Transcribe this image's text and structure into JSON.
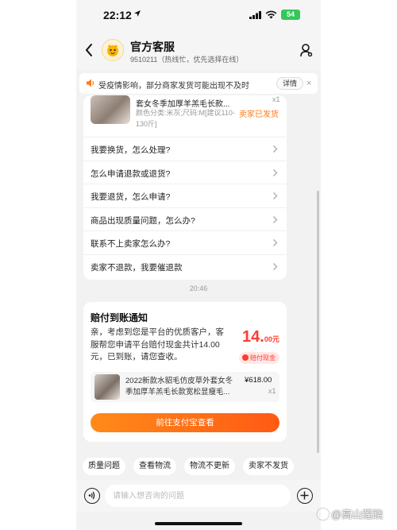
{
  "status_bar": {
    "time": "22:12",
    "battery": "54"
  },
  "header": {
    "title": "官方客服",
    "subtitle": "9510211（热线忙，优先选择在线）"
  },
  "notice": {
    "text": "受疫情影响，部分商家发货可能出现不及时",
    "detail_label": "详情",
    "close_glyph": "×"
  },
  "product": {
    "name": "套女冬季加厚羊羔毛长款...",
    "spec": "颜色分类:米灰;尺码:M[建议110-130斤]",
    "qty": "x1",
    "status": "卖家已发货"
  },
  "faq": [
    {
      "question": "我要换货，怎么处理?"
    },
    {
      "question": "怎么申请退款或退货?"
    },
    {
      "question": "我要退货，怎么申请?"
    },
    {
      "question": "商品出现质量问题，怎么办?"
    },
    {
      "question": "联系不上卖家怎么办?"
    },
    {
      "question": "卖家不退款，我要催退款"
    }
  ],
  "timestamp": "20:46",
  "compensation": {
    "title": "赔付到账通知",
    "body": "亲，考虑到您是平台的优质客户，客服帮您申请平台赔付现金共计14.00元，已到账，请您查收。",
    "amount_main": "14.",
    "amount_decimal": "00元",
    "tag": "赔付现金",
    "order": {
      "name": "2022新款水貂毛仿皮草外套女冬季加厚羊羔毛长款宽松显瘦毛...",
      "price": "¥618.00",
      "qty": "x1"
    },
    "button_label": "前往支付宝查看"
  },
  "quick_replies": [
    "质量问题",
    "查看物流",
    "物流不更新",
    "卖家不发货"
  ],
  "input": {
    "placeholder": "请输入想咨询的问题"
  },
  "watermark": "@高山莲跷",
  "colors": {
    "accent_orange": "#ff7a1a",
    "price_red": "#ff3b30",
    "battery_green": "#35c759"
  }
}
